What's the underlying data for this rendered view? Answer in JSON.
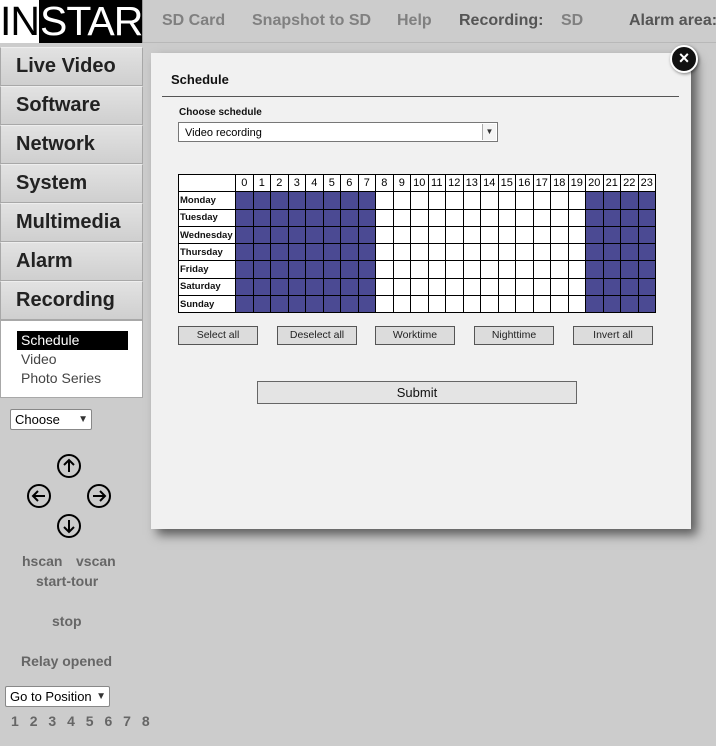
{
  "logo": {
    "left": "IN",
    "right": "STAR"
  },
  "topnav": {
    "sd_card": "SD Card",
    "snapshot": "Snapshot to SD",
    "help": "Help",
    "recording_label": "Recording:",
    "recording_value": "SD",
    "alarm_label": "Alarm area:"
  },
  "sidebar": {
    "items": [
      {
        "label": "Live Video"
      },
      {
        "label": "Software"
      },
      {
        "label": "Network"
      },
      {
        "label": "System"
      },
      {
        "label": "Multimedia"
      },
      {
        "label": "Alarm"
      },
      {
        "label": "Recording"
      }
    ],
    "submenu": [
      {
        "label": "Schedule",
        "active": true
      },
      {
        "label": "Video"
      },
      {
        "label": "Photo Series"
      }
    ]
  },
  "controls": {
    "preset_select": "Choose",
    "hscan": "hscan",
    "vscan": "vscan",
    "start_tour": "start-tour",
    "stop": "stop",
    "relay": "Relay opened",
    "goto_select": "Go to Position",
    "positions": [
      "1",
      "2",
      "3",
      "4",
      "5",
      "6",
      "7",
      "8"
    ]
  },
  "modal": {
    "title": "Schedule",
    "choose_label": "Choose schedule",
    "schedule_value": "Video recording",
    "hours": [
      "0",
      "1",
      "2",
      "3",
      "4",
      "5",
      "6",
      "7",
      "8",
      "9",
      "10",
      "11",
      "12",
      "13",
      "14",
      "15",
      "16",
      "17",
      "18",
      "19",
      "20",
      "21",
      "22",
      "23"
    ],
    "days": [
      "Monday",
      "Tuesday",
      "Wednesday",
      "Thursday",
      "Friday",
      "Saturday",
      "Sunday"
    ],
    "active_hours": [
      0,
      1,
      2,
      3,
      4,
      5,
      6,
      7,
      20,
      21,
      22,
      23
    ],
    "buttons": {
      "select_all": "Select all",
      "deselect_all": "Deselect all",
      "worktime": "Worktime",
      "nighttime": "Nighttime",
      "invert_all": "Invert all"
    },
    "submit": "Submit",
    "close": "×"
  },
  "colors": {
    "active_cell": "#4b4a93",
    "background": "#cccccc"
  }
}
